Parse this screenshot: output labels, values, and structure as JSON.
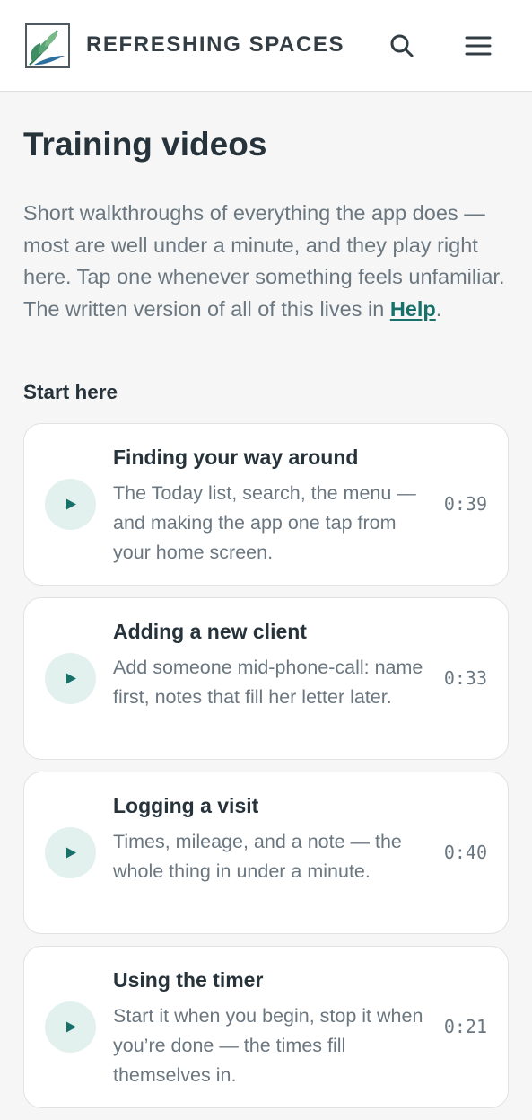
{
  "header": {
    "brand": "REFRESHING SPACES",
    "logo_icon": "leaf-logo-icon",
    "search_icon": "search-icon",
    "menu_icon": "hamburger-menu-icon",
    "accent_color": "#17706a"
  },
  "page": {
    "title": "Training videos",
    "intro_text": "Short walkthroughs of everything the app does — most are well under a minute, and they play right here. Tap one whenever something feels unfamiliar. The written version of all of this lives in ",
    "intro_link": "Help",
    "intro_end": "."
  },
  "section": {
    "title": "Start here"
  },
  "videos": [
    {
      "title": "Finding your way around",
      "description": "The Today list, search, the menu — and making the app one tap from your home screen.",
      "duration": "0:39",
      "icon": "play-icon"
    },
    {
      "title": "Adding a new client",
      "description": "Add someone mid-phone-call: name first, notes that fill her letter later.",
      "duration": "0:33",
      "icon": "play-icon"
    },
    {
      "title": "Logging a visit",
      "description": "Times, mileage, and a note — the whole thing in under a minute.",
      "duration": "0:40",
      "icon": "play-icon"
    },
    {
      "title": "Using the timer",
      "description": "Start it when you begin, stop it when you’re done — the times fill themselves in.",
      "duration": "0:21",
      "icon": "play-icon"
    }
  ]
}
